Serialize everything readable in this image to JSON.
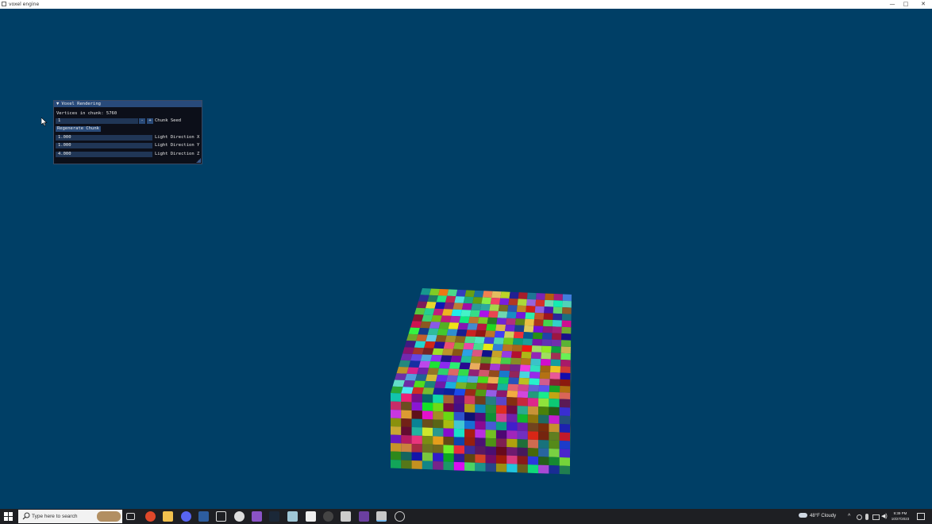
{
  "window": {
    "title": "voxel engine",
    "minimize_glyph": "—",
    "maximize_glyph": "□",
    "close_glyph": "✕"
  },
  "panel": {
    "title": "Voxel Rendering",
    "vertices_label": "Vertices in chunk: 5760",
    "seed": {
      "value": "1",
      "minus": "-",
      "plus": "+",
      "label": "Chunk Seed"
    },
    "regenerate_label": "Regenerate Chunk",
    "light_x": {
      "value": "1.000",
      "label": "Light Direction X"
    },
    "light_y": {
      "value": "1.000",
      "label": "Light Direction Y"
    },
    "light_z": {
      "value": "4.000",
      "label": "Light Direction Z"
    }
  },
  "taskbar": {
    "search_placeholder": "Type here to search",
    "weather": "48°F  Cloudy",
    "time": "9:39 PM",
    "date": "10/27/2023",
    "icons": [
      "task-view",
      "firefox",
      "file-explorer",
      "discord",
      "app",
      "unity",
      "github",
      "visual-studio",
      "steam",
      "notepad",
      "epic-games",
      "obs",
      "app",
      "ide",
      "terminal",
      "settings"
    ]
  },
  "colors": {
    "background": "#003f66",
    "panel_bg": "#0c0e16",
    "panel_header": "#284a7a",
    "field_bg": "#203656",
    "button_bg": "#294a78"
  }
}
